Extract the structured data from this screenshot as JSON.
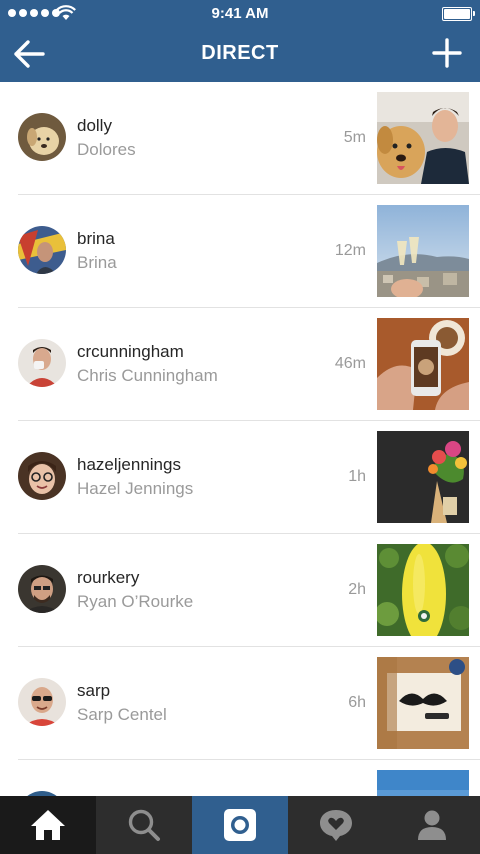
{
  "status_bar": {
    "time": "9:41 AM"
  },
  "header": {
    "title": "DIRECT"
  },
  "threads": [
    {
      "username": "dolly",
      "full_name": "Dolores",
      "time": "5m"
    },
    {
      "username": "brina",
      "full_name": "Brina",
      "time": "12m"
    },
    {
      "username": "crcunningham",
      "full_name": "Chris Cunningham",
      "time": "46m"
    },
    {
      "username": "hazeljennings",
      "full_name": "Hazel Jennings",
      "time": "1h"
    },
    {
      "username": "rourkery",
      "full_name": "Ryan O’Rourke",
      "time": "2h"
    },
    {
      "username": "sarp",
      "full_name": "Sarp Centel",
      "time": "6h"
    },
    {
      "username": "",
      "full_name": "",
      "time": ""
    }
  ],
  "tabbar": {
    "tabs": [
      "home-icon",
      "search-icon",
      "camera-icon",
      "activity-icon",
      "profile-icon"
    ],
    "active": [
      "home",
      "camera"
    ]
  },
  "colors": {
    "header": "#305f8f",
    "tabbar": "#2d2d2d",
    "tabbar_active": "#305f8f"
  }
}
